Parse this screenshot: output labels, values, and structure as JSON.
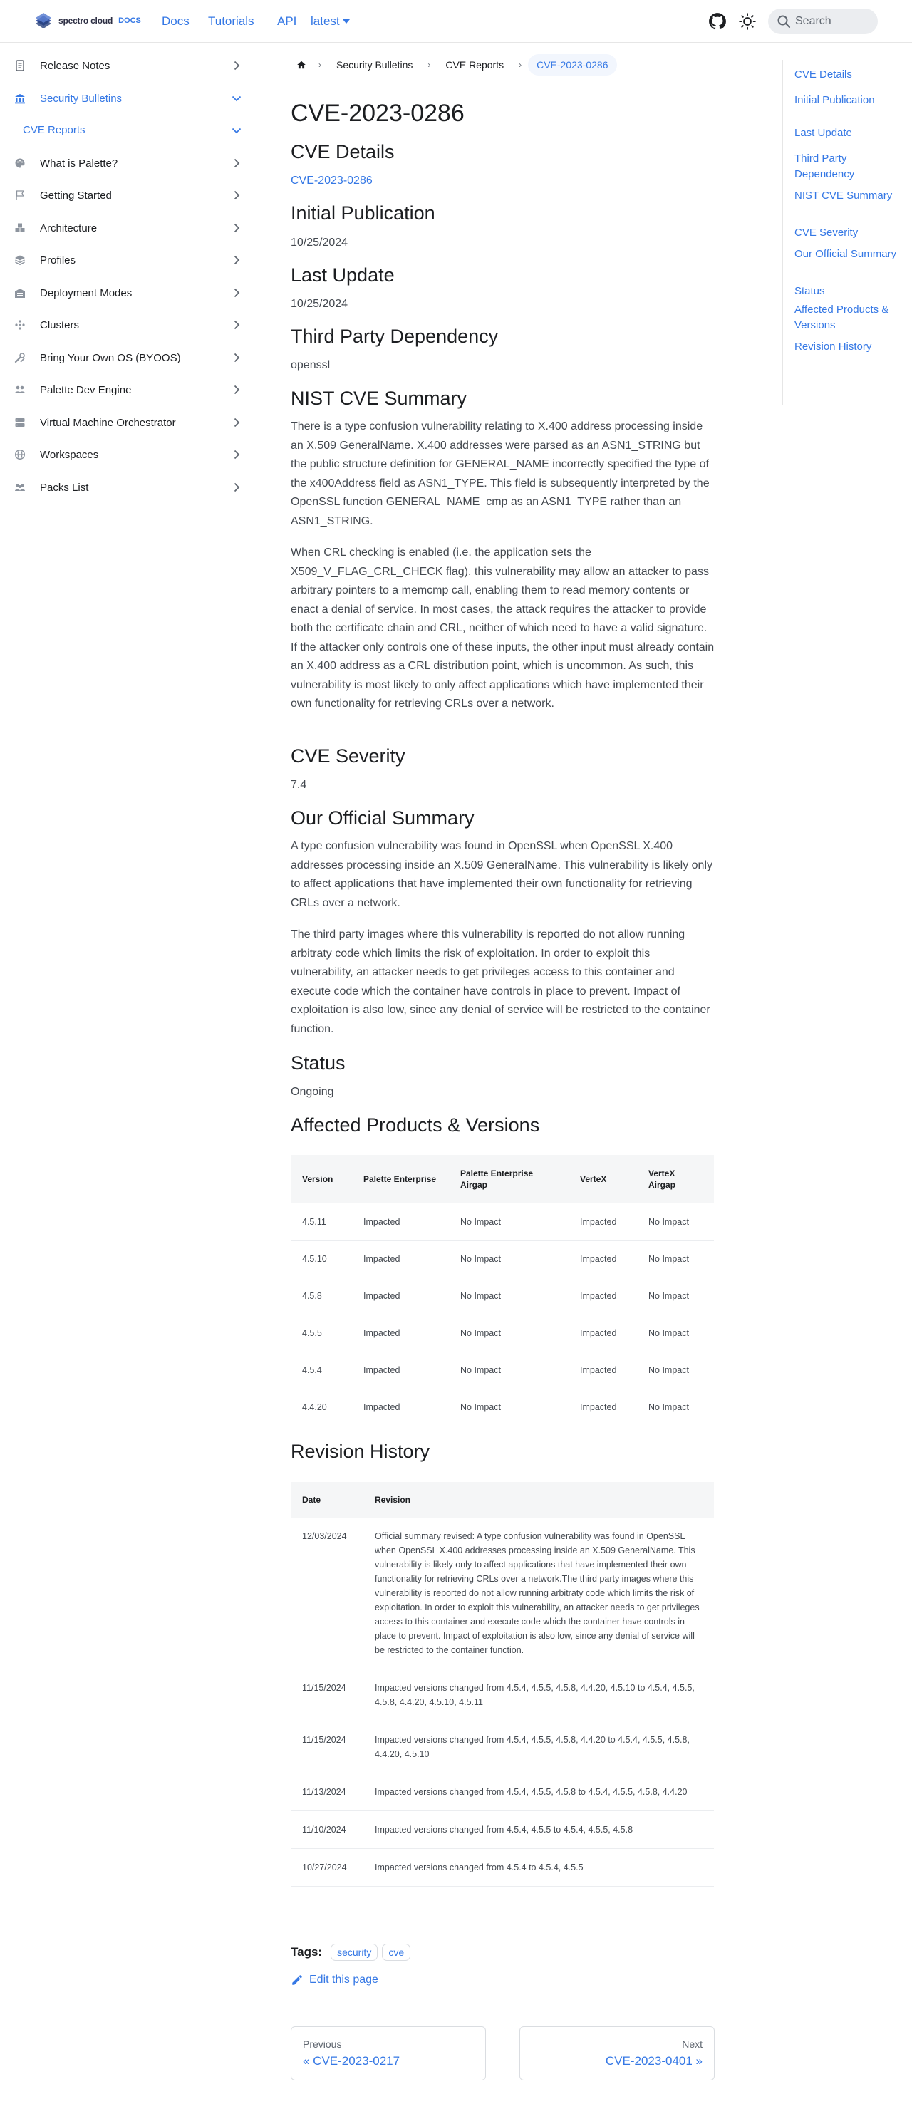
{
  "navbar": {
    "brand": "spectro cloud",
    "brand_suffix": "DOCS",
    "links": [
      "Docs",
      "Tutorials",
      "API"
    ],
    "version": "latest",
    "search_placeholder": "Search"
  },
  "sidebar": {
    "items": [
      {
        "label": "Release Notes",
        "icon": "document-icon"
      },
      {
        "label": "Security Bulletins",
        "icon": "bank-icon",
        "active": true
      },
      {
        "label": "CVE Reports",
        "sub": true
      },
      {
        "label": "What is Palette?",
        "icon": "palette-icon"
      },
      {
        "label": "Getting Started",
        "icon": "flag-icon"
      },
      {
        "label": "Architecture",
        "icon": "cubes-icon"
      },
      {
        "label": "Profiles",
        "icon": "layers-icon"
      },
      {
        "label": "Deployment Modes",
        "icon": "warehouse-icon"
      },
      {
        "label": "Clusters",
        "icon": "nodes-icon"
      },
      {
        "label": "Bring Your Own OS (BYOOS)",
        "icon": "tools-icon"
      },
      {
        "label": "Palette Dev Engine",
        "icon": "users-icon"
      },
      {
        "label": "Virtual Machine Orchestrator",
        "icon": "server-icon"
      },
      {
        "label": "Workspaces",
        "icon": "globe-icon"
      },
      {
        "label": "Packs List",
        "icon": "people-icon"
      }
    ]
  },
  "breadcrumb": [
    "Security Bulletins",
    "CVE Reports",
    "CVE-2023-0286"
  ],
  "page": {
    "title": "CVE-2023-0286",
    "cve_details_heading": "CVE Details",
    "cve_details_link": "CVE-2023-0286",
    "initial_pub_heading": "Initial Publication",
    "initial_pub": "10/25/2024",
    "last_update_heading": "Last Update",
    "last_update": "10/25/2024",
    "third_party_heading": "Third Party Dependency",
    "third_party": "openssl",
    "nist_heading": "NIST CVE Summary",
    "nist_p1": "There is a type confusion vulnerability relating to X.400 address processing inside an X.509 GeneralName. X.400 addresses were parsed as an ASN1_STRING but the public structure definition for GENERAL_NAME incorrectly specified the type of the x400Address field as ASN1_TYPE. This field is subsequently interpreted by the OpenSSL function GENERAL_NAME_cmp as an ASN1_TYPE rather than an ASN1_STRING.",
    "nist_p2": "When CRL checking is enabled (i.e. the application sets the X509_V_FLAG_CRL_CHECK flag), this vulnerability may allow an attacker to pass arbitrary pointers to a memcmp call, enabling them to read memory contents or enact a denial of service. In most cases, the attack requires the attacker to provide both the certificate chain and CRL, neither of which need to have a valid signature. If the attacker only controls one of these inputs, the other input must already contain an X.400 address as a CRL distribution point, which is uncommon. As such, this vulnerability is most likely to only affect applications which have implemented their own functionality for retrieving CRLs over a network.",
    "severity_heading": "CVE Severity",
    "severity": "7.4",
    "official_heading": "Our Official Summary",
    "official_p1": "A type confusion vulnerability was found in OpenSSL when OpenSSL X.400 addresses processing inside an X.509 GeneralName. This vulnerability is likely only to affect applications that have implemented their own functionality for retrieving CRLs over a network.",
    "official_p2": "The third party images where this vulnerability is reported do not allow running arbitraty code which limits the risk of exploitation. In order to exploit this vulnerability, an attacker needs to get privileges access to this container and execute code which the container have controls in place to prevent. Impact of exploitation is also low, since any denial of service will be restricted to the container function.",
    "status_heading": "Status",
    "status": "Ongoing",
    "affected_heading": "Affected Products & Versions",
    "revision_heading": "Revision History"
  },
  "affected_table": {
    "headers": [
      "Version",
      "Palette Enterprise",
      "Palette Enterprise Airgap",
      "VerteX",
      "VerteX Airgap"
    ],
    "rows": [
      [
        "4.5.11",
        "Impacted",
        "No Impact",
        "Impacted",
        "No Impact"
      ],
      [
        "4.5.10",
        "Impacted",
        "No Impact",
        "Impacted",
        "No Impact"
      ],
      [
        "4.5.8",
        "Impacted",
        "No Impact",
        "Impacted",
        "No Impact"
      ],
      [
        "4.5.5",
        "Impacted",
        "No Impact",
        "Impacted",
        "No Impact"
      ],
      [
        "4.5.4",
        "Impacted",
        "No Impact",
        "Impacted",
        "No Impact"
      ],
      [
        "4.4.20",
        "Impacted",
        "No Impact",
        "Impacted",
        "No Impact"
      ]
    ]
  },
  "revision_table": {
    "headers": [
      "Date",
      "Revision"
    ],
    "rows": [
      [
        "12/03/2024",
        "Official summary revised: A type confusion vulnerability was found in OpenSSL when OpenSSL X.400 addresses processing inside an X.509 GeneralName. This vulnerability is likely only to affect applications that have implemented their own functionality for retrieving CRLs over a network.The third party images where this vulnerability is reported do not allow running arbitraty code which limits the risk of exploitation. In order to exploit this vulnerability, an attacker needs to get privileges access to this container and execute code which the container have controls in place to prevent. Impact of exploitation is also low, since any denial of service will be restricted to the container function."
      ],
      [
        "11/15/2024",
        "Impacted versions changed from 4.5.4, 4.5.5, 4.5.8, 4.4.20, 4.5.10 to 4.5.4, 4.5.5, 4.5.8, 4.4.20, 4.5.10, 4.5.11"
      ],
      [
        "11/15/2024",
        "Impacted versions changed from 4.5.4, 4.5.5, 4.5.8, 4.4.20 to 4.5.4, 4.5.5, 4.5.8, 4.4.20, 4.5.10"
      ],
      [
        "11/13/2024",
        "Impacted versions changed from 4.5.4, 4.5.5, 4.5.8 to 4.5.4, 4.5.5, 4.5.8, 4.4.20"
      ],
      [
        "11/10/2024",
        "Impacted versions changed from 4.5.4, 4.5.5 to 4.5.4, 4.5.5, 4.5.8"
      ],
      [
        "10/27/2024",
        "Impacted versions changed from 4.5.4 to 4.5.4, 4.5.5"
      ]
    ]
  },
  "tags": {
    "label": "Tags:",
    "items": [
      "security",
      "cve"
    ]
  },
  "edit_label": "Edit this page",
  "pager": {
    "prev_sub": "Previous",
    "prev_title": "« CVE-2023-0217",
    "next_sub": "Next",
    "next_title": "CVE-2023-0401 »"
  },
  "toc": [
    "CVE Details",
    "Initial Publication",
    "Last Update",
    "Third Party Dependency",
    "NIST CVE Summary",
    "CVE Severity",
    "Our Official Summary",
    "Status",
    "Affected Products & Versions",
    "Revision History"
  ],
  "colors": {
    "accent": "#3578e5",
    "text": "#1c1e21",
    "muted": "#444950"
  }
}
